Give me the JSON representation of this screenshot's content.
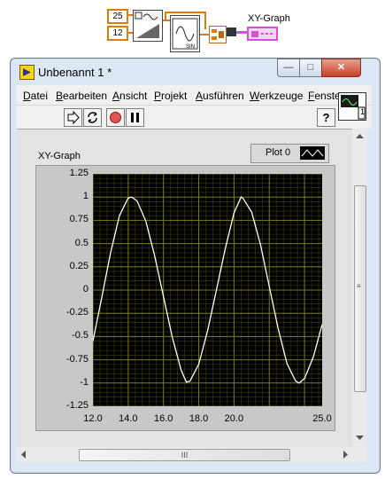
{
  "block_diagram": {
    "const_top": "25",
    "const_bottom": "12",
    "graph_label": "XY-Graph",
    "sine_vi_label": "SIN"
  },
  "window": {
    "title": "Unbenannt 1 *",
    "minimize_icon": "minimize-icon",
    "restore_icon": "restore-icon",
    "close_icon": "close-icon"
  },
  "menu": {
    "items": [
      {
        "u": "D",
        "rest": "atei"
      },
      {
        "u": "B",
        "rest": "earbeiten"
      },
      {
        "u": "A",
        "rest": "nsicht"
      },
      {
        "u": "P",
        "rest": "rojekt"
      },
      {
        "u": "A",
        "rest": "usführen"
      },
      {
        "u": "W",
        "rest": "erkzeuge"
      },
      {
        "u": "F",
        "rest": "enste"
      }
    ]
  },
  "toolbar": {
    "run_icon": "run-arrow-icon",
    "run_continuous_icon": "run-continuously-icon",
    "abort_icon": "abort-icon",
    "pause_icon": "pause-icon",
    "help_label": "?",
    "vi_icon_number": "1"
  },
  "graph": {
    "label": "XY-Graph",
    "legend_label": "Plot 0",
    "scroll_grip": "III",
    "colors": {
      "plot_bg": "#000000",
      "grid": "#7a7a1a",
      "curve": "#ffffff"
    }
  },
  "chart_data": {
    "type": "line",
    "title": "XY-Graph",
    "xlabel": "",
    "ylabel": "",
    "xlim": [
      12.0,
      25.0
    ],
    "ylim": [
      -1.25,
      1.25
    ],
    "x_ticks": [
      "12.0",
      "14.0",
      "16.0",
      "18.0",
      "20.0",
      "25.0"
    ],
    "y_ticks": [
      "1.25",
      "1",
      "0.75",
      "0.5",
      "0.25",
      "0",
      "-0.25",
      "-0.5",
      "-0.75",
      "-1",
      "-1.25"
    ],
    "series": [
      {
        "name": "Plot 0",
        "x": [
          12.0,
          12.5,
          13.0,
          13.5,
          14.0,
          14.2,
          14.5,
          15.0,
          15.5,
          16.0,
          16.5,
          17.0,
          17.3,
          17.5,
          18.0,
          18.5,
          19.0,
          19.5,
          20.0,
          20.4,
          20.5,
          21.0,
          21.5,
          22.0,
          22.5,
          23.0,
          23.5,
          23.7,
          24.0,
          24.5,
          25.0
        ],
        "y": [
          -0.55,
          -0.08,
          0.4,
          0.8,
          0.99,
          1.0,
          0.96,
          0.74,
          0.37,
          -0.07,
          -0.51,
          -0.86,
          -0.99,
          -0.98,
          -0.8,
          -0.44,
          0.0,
          0.44,
          0.83,
          1.0,
          0.99,
          0.84,
          0.49,
          0.04,
          -0.41,
          -0.79,
          -0.98,
          -1.0,
          -0.95,
          -0.72,
          -0.37
        ]
      }
    ],
    "grid": true,
    "legend": "top-right"
  }
}
